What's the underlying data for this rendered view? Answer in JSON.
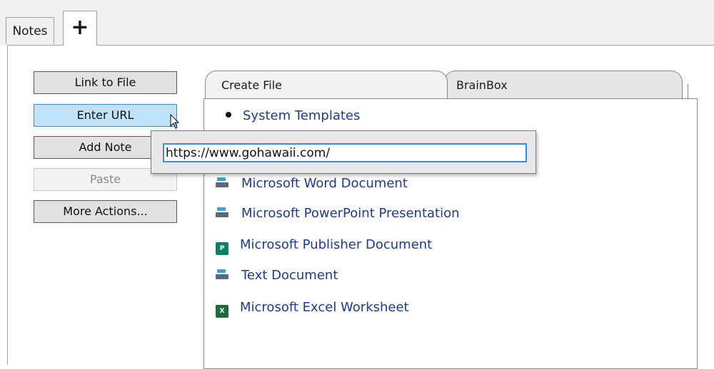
{
  "window_tabs": {
    "notes": "Notes",
    "add": "+"
  },
  "sidebar": {
    "link_to_file": "Link to File",
    "enter_url": "Enter URL",
    "add_note": "Add Note",
    "paste": "Paste",
    "more_actions": "More Actions..."
  },
  "file_tabs": {
    "create_file": "Create File",
    "brainbox": "BrainBox"
  },
  "list": {
    "section": "System Templates",
    "items": [
      "Microsoft Word Document",
      "Microsoft PowerPoint Presentation",
      "Microsoft Publisher Document",
      "Text Document",
      "Microsoft Excel Worksheet"
    ]
  },
  "url_popup": {
    "value": "https://www.gohawaii.com/"
  },
  "icons": {
    "publisher": "P",
    "excel": "X"
  },
  "colors": {
    "hover_button": "#bfe3fa",
    "link_text": "#1f3b8c",
    "input_border": "#3b8fd9"
  }
}
